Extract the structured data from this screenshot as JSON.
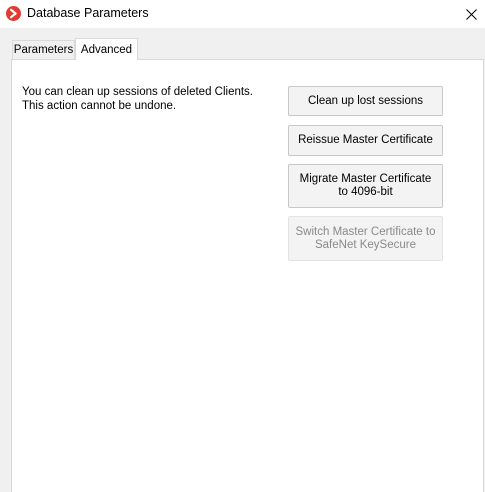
{
  "window": {
    "title": "Database Parameters",
    "app_icon": "app-logo-icon",
    "close_icon": "close-icon"
  },
  "tabs": [
    {
      "label": "Parameters",
      "selected": false
    },
    {
      "label": "Advanced",
      "selected": true
    }
  ],
  "advanced": {
    "info_text": "You can clean up sessions of deleted Clients. This action cannot be undone.",
    "buttons": [
      {
        "label": "Clean up lost sessions",
        "enabled": true
      },
      {
        "label": "Reissue Master Certificate",
        "enabled": true
      },
      {
        "label": "Migrate Master Certificate to 4096-bit",
        "enabled": true
      },
      {
        "label": "Switch Master Certificate to SafeNet KeySecure",
        "enabled": false
      }
    ]
  },
  "colors": {
    "brand_red": "#e03c31",
    "disabled_text": "#8a8a8a"
  }
}
